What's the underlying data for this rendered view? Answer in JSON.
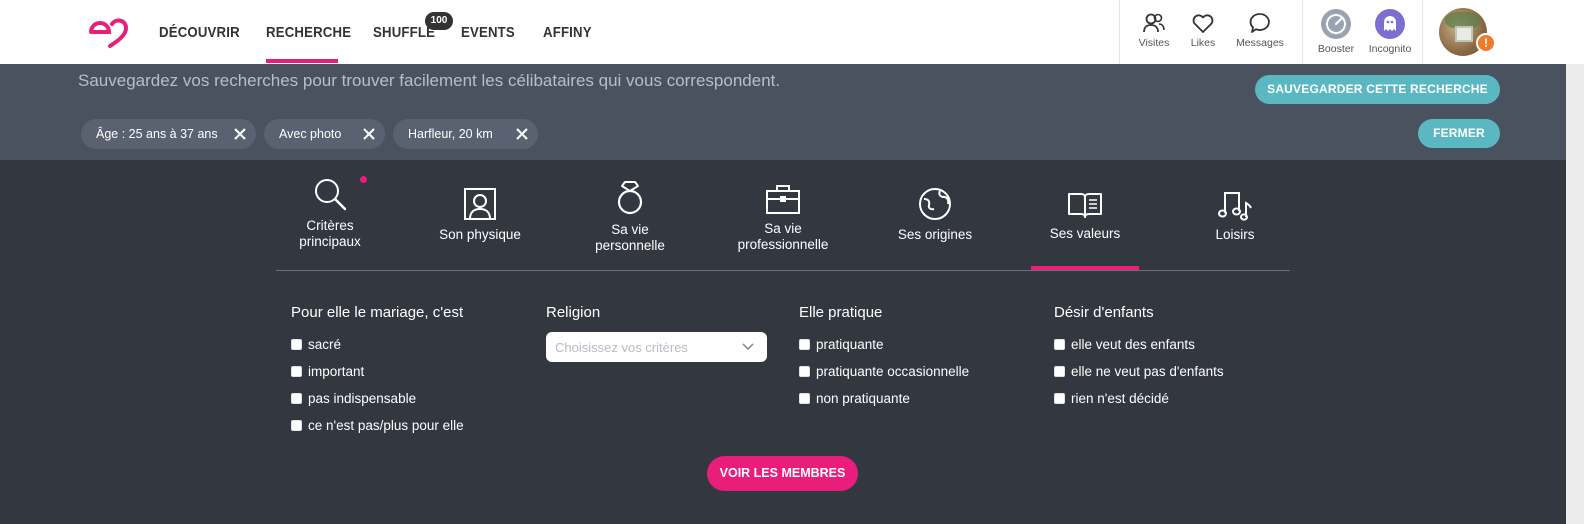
{
  "nav": {
    "items": [
      "DÉCOUVRIR",
      "RECHERCHE",
      "SHUFFLE",
      "EVENTS",
      "AFFINY"
    ],
    "shuffle_badge": "100",
    "icons": [
      {
        "name": "visits-icon",
        "label": "Visites"
      },
      {
        "name": "heart-icon",
        "label": "Likes"
      },
      {
        "name": "message-icon",
        "label": "Messages"
      },
      {
        "name": "booster-icon",
        "label": "Booster"
      },
      {
        "name": "ghost-icon",
        "label": "Incognito"
      }
    ],
    "alert_badge": "!"
  },
  "save": {
    "text": "Sauvegardez vos recherches pour trouver facilement les célibataires qui vous correspondent.",
    "save_button": "SAUVEGARDER CETTE RECHERCHE",
    "close_button": "FERMER",
    "chips": [
      "Âge : 25 ans à 37 ans",
      "Avec photo",
      "Harfleur, 20 km"
    ]
  },
  "tabs": [
    {
      "icon": "search-icon",
      "label_1": "Critères",
      "label_2": "principaux"
    },
    {
      "icon": "portrait-icon",
      "label_1": "Son physique",
      "label_2": ""
    },
    {
      "icon": "ring-icon",
      "label_1": "Sa vie",
      "label_2": "personnelle"
    },
    {
      "icon": "briefcase-icon",
      "label_1": "Sa vie",
      "label_2": "professionnelle"
    },
    {
      "icon": "globe-icon",
      "label_1": "Ses origines",
      "label_2": ""
    },
    {
      "icon": "book-icon",
      "label_1": "Ses valeurs",
      "label_2": ""
    },
    {
      "icon": "music-icon",
      "label_1": "Loisirs",
      "label_2": ""
    }
  ],
  "criteria": {
    "marriage": {
      "title": "Pour elle le mariage, c'est",
      "options": [
        "sacré",
        "important",
        "pas indispensable",
        "ce n'est pas/plus pour elle"
      ]
    },
    "religion": {
      "title": "Religion",
      "placeholder": "Choisissez vos critères"
    },
    "practice": {
      "title": "Elle pratique",
      "options": [
        "pratiquante",
        "pratiquante occasionnelle",
        "non pratiquante"
      ]
    },
    "children": {
      "title": "Désir d'enfants",
      "options": [
        "elle veut des enfants",
        "elle ne veut pas d'enfants",
        "rien n'est décidé"
      ]
    }
  },
  "cta": "VOIR LES MEMBRES",
  "colors": {
    "accent": "#e91e7a",
    "teal": "#5bb8c2",
    "panel": "#323740",
    "band": "#4a5260"
  }
}
